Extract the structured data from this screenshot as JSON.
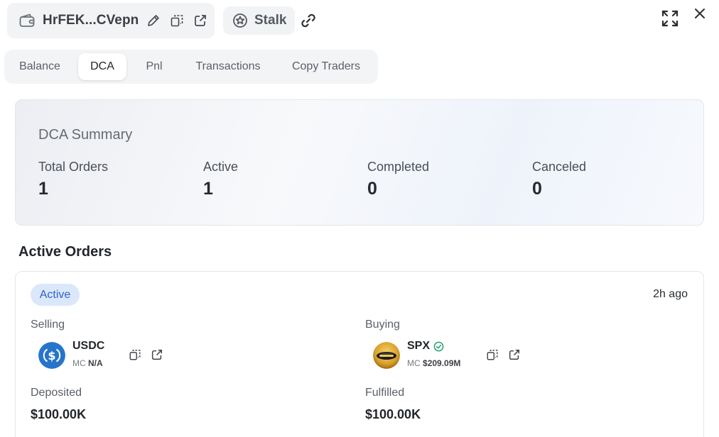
{
  "header": {
    "wallet_name": "HrFEK...CVepn",
    "stalk_label": "Stalk"
  },
  "tabs": [
    {
      "label": "Balance",
      "active": false
    },
    {
      "label": "DCA",
      "active": true
    },
    {
      "label": "Pnl",
      "active": false
    },
    {
      "label": "Transactions",
      "active": false
    },
    {
      "label": "Copy Traders",
      "active": false
    }
  ],
  "summary": {
    "title": "DCA Summary",
    "stats": [
      {
        "label": "Total Orders",
        "value": "1"
      },
      {
        "label": "Active",
        "value": "1"
      },
      {
        "label": "Completed",
        "value": "0"
      },
      {
        "label": "Canceled",
        "value": "0"
      }
    ]
  },
  "active_orders": {
    "title": "Active Orders",
    "orders": [
      {
        "status": "Active",
        "time": "2h ago",
        "selling": {
          "label": "Selling",
          "symbol": "USDC",
          "mc_label": "MC",
          "mc_value": "N/A",
          "icon": "usdc-logo"
        },
        "buying": {
          "label": "Buying",
          "symbol": "SPX",
          "mc_label": "MC",
          "mc_value": "$209.09M",
          "icon": "spx-logo",
          "verified": true
        },
        "deposited": {
          "label": "Deposited",
          "value": "$100.00K"
        },
        "fulfilled": {
          "label": "Fulfilled",
          "value": "$100.00K"
        }
      }
    ]
  },
  "colors": {
    "badge_bg": "#dbe7fb",
    "badge_text": "#2e63c7",
    "usdc_blue": "#2775ca",
    "verified_green": "#22a06b"
  }
}
